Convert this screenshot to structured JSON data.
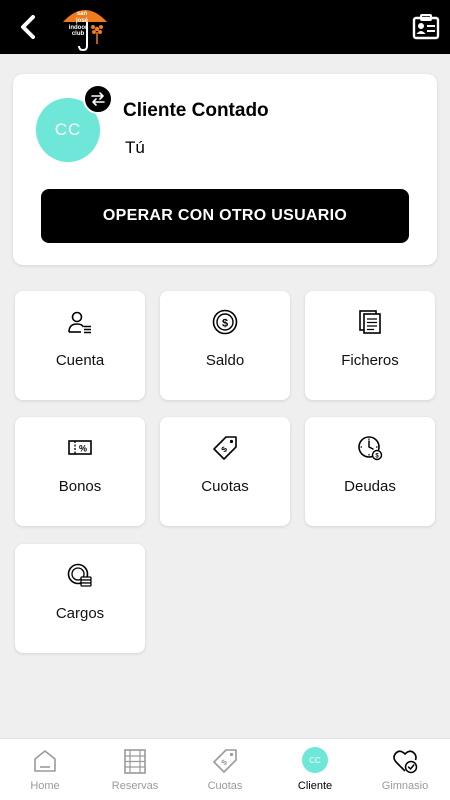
{
  "header": {
    "logo_text": [
      "san",
      "josé",
      "indoor",
      "club"
    ],
    "brand_color": "#f07a1e",
    "back_icon": "chevron-left-icon",
    "card_icon": "id-card-icon"
  },
  "profile": {
    "avatar_initials": "CC",
    "avatar_color": "#6ee7d8",
    "name": "Cliente Contado",
    "subtitle": "Tú",
    "operate_button": "OPERAR CON OTRO USUARIO"
  },
  "tiles": [
    {
      "label": "Cuenta",
      "icon": "user-list-icon"
    },
    {
      "label": "Saldo",
      "icon": "coin-icon"
    },
    {
      "label": "Ficheros",
      "icon": "documents-icon"
    },
    {
      "label": "Bonos",
      "icon": "voucher-icon"
    },
    {
      "label": "Cuotas",
      "icon": "price-tag-icon"
    },
    {
      "label": "Deudas",
      "icon": "clock-coin-icon"
    },
    {
      "label": "Cargos",
      "icon": "coin-stack-icon"
    }
  ],
  "bottom_nav": {
    "items": [
      {
        "label": "Home",
        "icon": "home-icon"
      },
      {
        "label": "Reservas",
        "icon": "calendar-grid-icon"
      },
      {
        "label": "Cuotas",
        "icon": "price-tag-icon"
      },
      {
        "label": "Cliente",
        "icon": "avatar",
        "initials": "CC",
        "active": true
      },
      {
        "label": "Gimnasio",
        "icon": "heart-check-icon"
      }
    ]
  }
}
